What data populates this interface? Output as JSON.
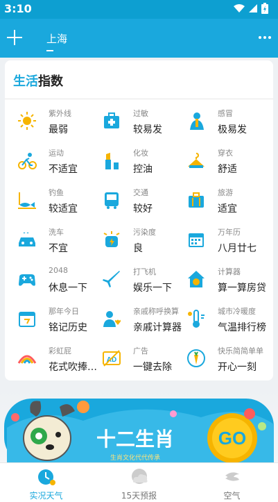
{
  "status_bar": {
    "time": "3:10"
  },
  "header": {
    "city": "上海"
  },
  "life_index": {
    "title_accent": "生活",
    "title_rest": "指数",
    "rows": [
      [
        {
          "label": "紫外线",
          "value": "最弱",
          "icon": "sun-icon"
        },
        {
          "label": "过敏",
          "value": "较易发",
          "icon": "medkit-icon"
        },
        {
          "label": "感冒",
          "value": "极易发",
          "icon": "cold-person-icon"
        }
      ],
      [
        {
          "label": "运动",
          "value": "不适宜",
          "icon": "cycling-icon"
        },
        {
          "label": "化妆",
          "value": "控油",
          "icon": "lipstick-icon"
        },
        {
          "label": "穿衣",
          "value": "舒适",
          "icon": "hanger-icon"
        }
      ],
      [
        {
          "label": "钓鱼",
          "value": "较适宜",
          "icon": "fishing-icon"
        },
        {
          "label": "交通",
          "value": "较好",
          "icon": "bus-icon"
        },
        {
          "label": "旅游",
          "value": "适宜",
          "icon": "suitcase-icon"
        }
      ],
      [
        {
          "label": "洗车",
          "value": "不宜",
          "icon": "car-icon"
        },
        {
          "label": "污染度",
          "value": "良",
          "icon": "pollution-icon"
        },
        {
          "label": "万年历",
          "value": "八月廿七",
          "icon": "calendar-icon"
        }
      ],
      [
        {
          "label": "2048",
          "value": "休息一下",
          "icon": "gamepad-icon"
        },
        {
          "label": "打飞机",
          "value": "娱乐一下",
          "icon": "airplane-icon"
        },
        {
          "label": "计算器",
          "value": "算一算房贷",
          "icon": "house-money-icon"
        }
      ],
      [
        {
          "label": "那年今日",
          "value": "铭记历史",
          "icon": "history-calendar-icon"
        },
        {
          "label": "亲戚称呼换算",
          "value": "亲戚计算器",
          "icon": "relatives-icon"
        },
        {
          "label": "城市冷暖度",
          "value": "气温排行榜",
          "icon": "thermometer-icon"
        }
      ],
      [
        {
          "label": "彩虹屁",
          "value": "花式吹捧…",
          "icon": "rainbow-icon"
        },
        {
          "label": "广告",
          "value": "一键去除",
          "icon": "no-ad-icon"
        },
        {
          "label": "快乐简简单单",
          "value": "开心一刻",
          "icon": "carrot-icon"
        }
      ]
    ]
  },
  "banner": {
    "title": "十二生肖",
    "subtitle": "生肖文化代代传承",
    "cta": "GO"
  },
  "bottom_nav": [
    {
      "label": "实况天气",
      "icon": "clock-weather-icon",
      "active": true
    },
    {
      "label": "15天预报",
      "icon": "cloud-icon",
      "active": false
    },
    {
      "label": "空气",
      "icon": "air-icon",
      "active": false
    }
  ]
}
